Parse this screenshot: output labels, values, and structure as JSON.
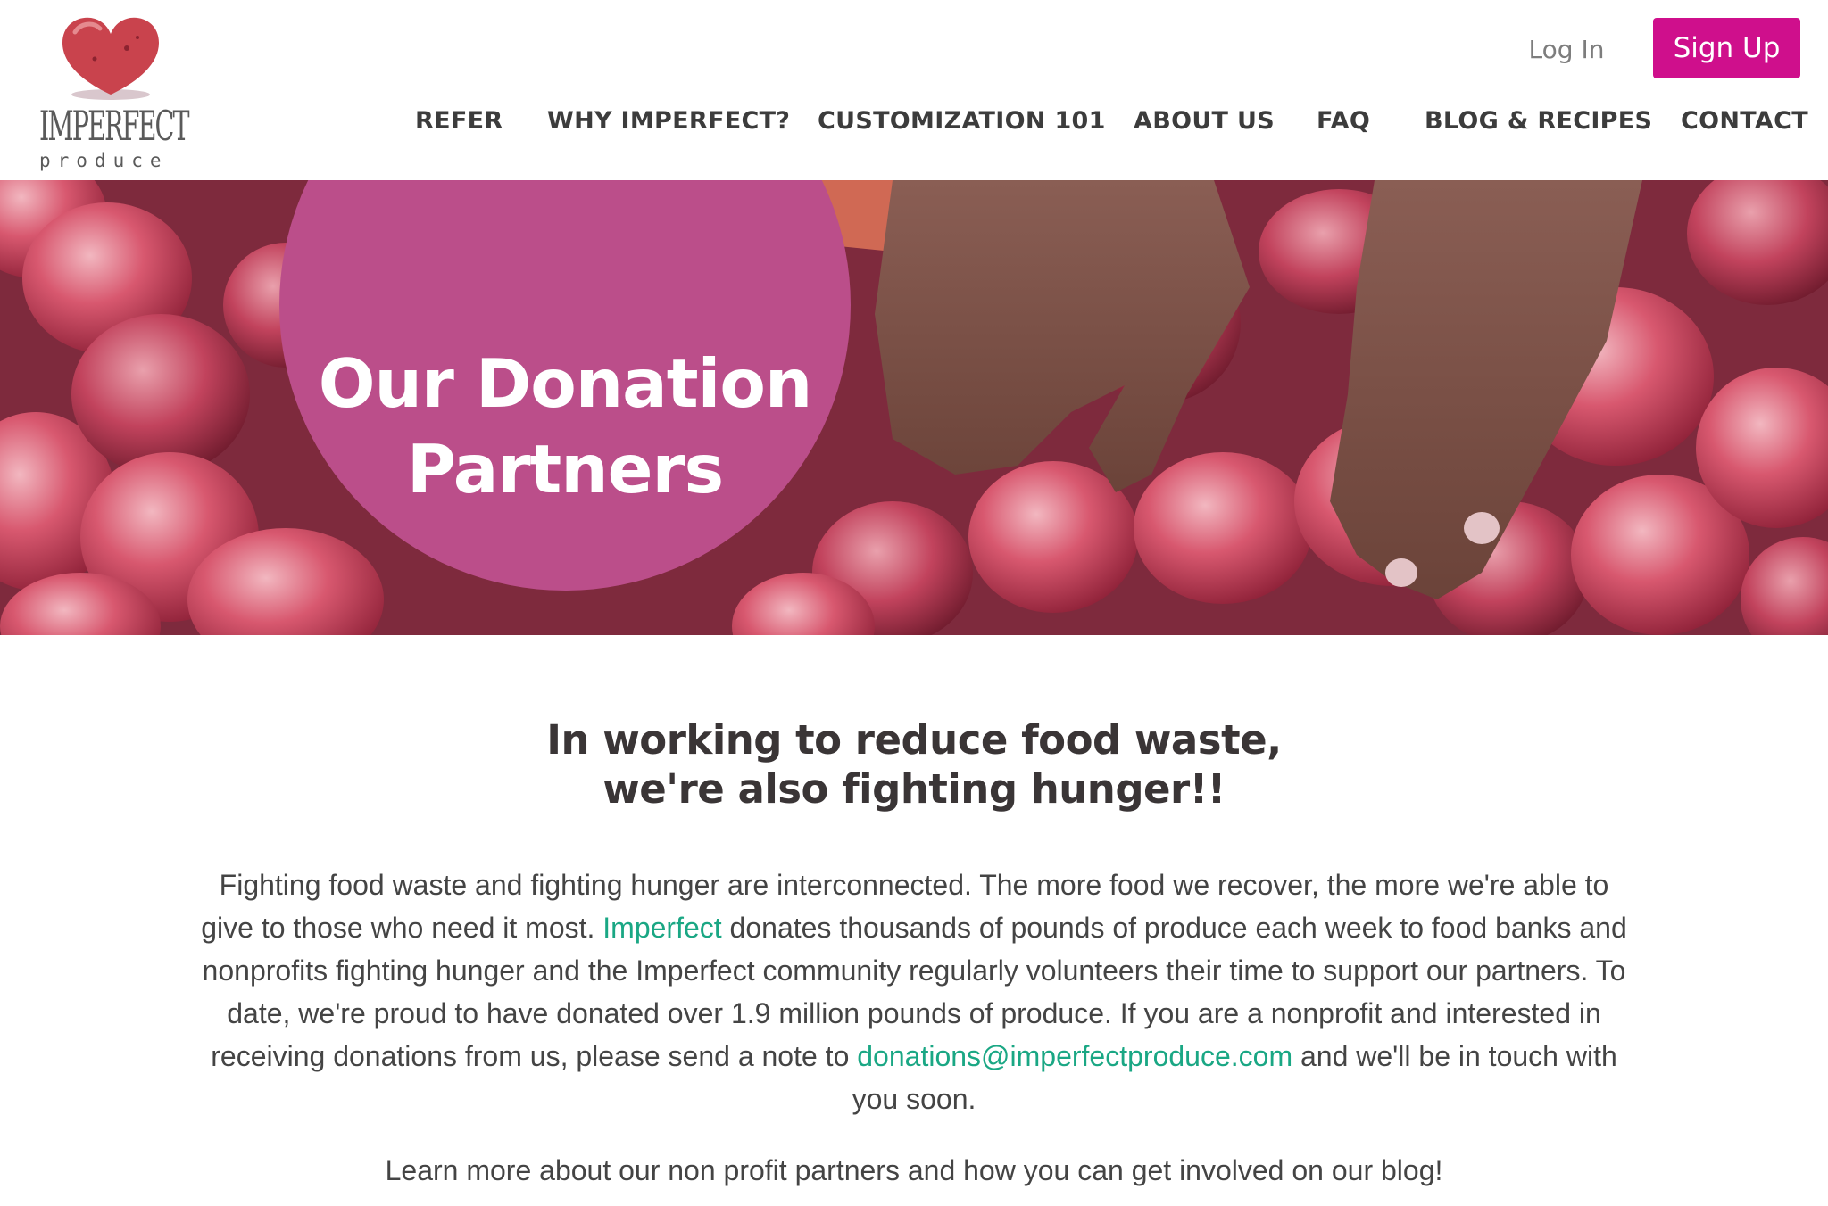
{
  "brand": {
    "logo_word": "IMPERFECT",
    "logo_sub": "produce",
    "primary_color": "#cf0f8c",
    "circle_color": "#bb4e8a",
    "link_color": "#1aa784"
  },
  "header": {
    "login_label": "Log In",
    "signup_label": "Sign Up"
  },
  "nav": {
    "items": [
      {
        "label": "REFER"
      },
      {
        "label": "WHY IMPERFECT?"
      },
      {
        "label": "CUSTOMIZATION 101"
      },
      {
        "label": "ABOUT US"
      },
      {
        "label": "FAQ"
      },
      {
        "label": "BLOG & RECIPES"
      },
      {
        "label": "CONTACT"
      }
    ]
  },
  "hero": {
    "title_line1": "Our Donation",
    "title_line2": "Partners"
  },
  "content": {
    "headline_line1": "In working to reduce food waste,",
    "headline_line2": "we're also fighting hunger!!",
    "para_part1": "Fighting food waste and fighting hunger are interconnected. The more food we recover, the more we're able to give to those who need it most. ",
    "para_link1": "Imperfect",
    "para_part2": " donates thousands of pounds of produce each week to food banks and nonprofits fighting hunger and the Imperfect community regularly volunteers their time to support our partners. To date, we're proud to have donated over 1.9 million pounds of produce. If you are a nonprofit and interested in receiving donations from us, please send a note to ",
    "para_link2": "donations@imperfectproduce.com",
    "para_part3": " and we'll be in touch with you soon.",
    "blog_line": "Learn more about our non profit partners and how you can get involved on our blog!"
  }
}
